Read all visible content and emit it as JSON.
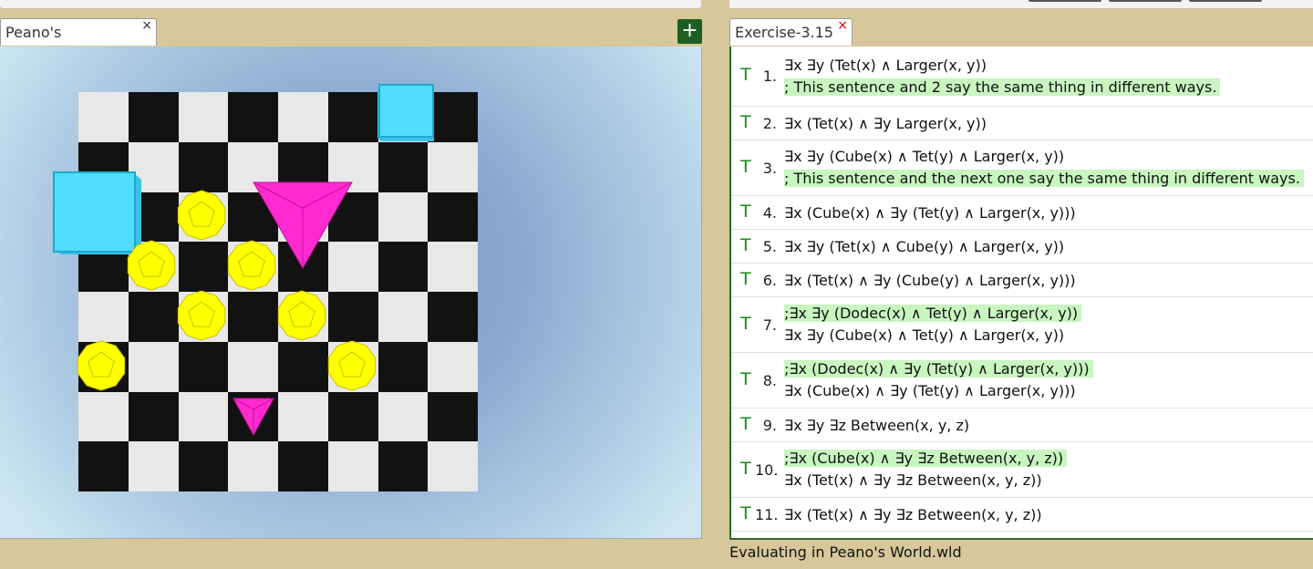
{
  "tabs": {
    "world": {
      "label": "Peano's World.wld",
      "close": "×"
    },
    "exercise": {
      "label": "Exercise-3.15",
      "close": "×"
    }
  },
  "toolbar": {
    "add_label": "+"
  },
  "colors": {
    "truth": "#1a8a1a",
    "comment_bg": "#c8f5c0",
    "cube": "#55ddff",
    "tet": "#ff2ad0",
    "dodec": "#ffff00",
    "add_button": "#1f5e23"
  },
  "sentences": [
    {
      "truth": "T",
      "num": "1.",
      "lines": [
        {
          "text": "∃x ∃y (Tet(x) ∧ Larger(x, y))",
          "comment": false
        },
        {
          "text": "; This sentence and 2 say the same thing in different ways.",
          "comment": true
        }
      ]
    },
    {
      "truth": "T",
      "num": "2.",
      "lines": [
        {
          "text": "∃x (Tet(x) ∧ ∃y Larger(x, y))",
          "comment": false
        }
      ]
    },
    {
      "truth": "T",
      "num": "3.",
      "lines": [
        {
          "text": "∃x ∃y (Cube(x) ∧ Tet(y) ∧ Larger(x, y))",
          "comment": false
        },
        {
          "text": "; This sentence and the next one say the same thing in different ways.",
          "comment": true
        }
      ]
    },
    {
      "truth": "T",
      "num": "4.",
      "lines": [
        {
          "text": "∃x (Cube(x) ∧ ∃y (Tet(y) ∧ Larger(x, y)))",
          "comment": false
        }
      ]
    },
    {
      "truth": "T",
      "num": "5.",
      "lines": [
        {
          "text": "∃x ∃y (Tet(x) ∧ Cube(y) ∧ Larger(x, y))",
          "comment": false
        }
      ]
    },
    {
      "truth": "T",
      "num": "6.",
      "lines": [
        {
          "text": "∃x (Tet(x) ∧ ∃y (Cube(y) ∧ Larger(x, y)))",
          "comment": false
        }
      ]
    },
    {
      "truth": "T",
      "num": "7.",
      "lines": [
        {
          "text": ";∃x ∃y (Dodec(x) ∧ Tet(y) ∧ Larger(x, y))",
          "comment": true
        },
        {
          "text": "∃x ∃y (Cube(x) ∧ Tet(y) ∧ Larger(x, y))",
          "comment": false
        }
      ]
    },
    {
      "truth": "T",
      "num": "8.",
      "lines": [
        {
          "text": ";∃x (Dodec(x) ∧ ∃y (Tet(y) ∧ Larger(x, y)))",
          "comment": true
        },
        {
          "text": "∃x (Cube(x) ∧ ∃y (Tet(y) ∧ Larger(x, y)))",
          "comment": false
        }
      ]
    },
    {
      "truth": "T",
      "num": "9.",
      "lines": [
        {
          "text": "∃x ∃y ∃z Between(x, y, z)",
          "comment": false
        }
      ]
    },
    {
      "truth": "T",
      "num": "10.",
      "lines": [
        {
          "text": ";∃x (Cube(x) ∧ ∃y ∃z Between(x, y, z))",
          "comment": true
        },
        {
          "text": "∃x (Tet(x) ∧ ∃y ∃z Between(x, y, z))",
          "comment": false
        }
      ]
    },
    {
      "truth": "T",
      "num": "11.",
      "lines": [
        {
          "text": "∃x (Tet(x) ∧ ∃y ∃z Between(x, y, z))",
          "comment": false
        }
      ]
    }
  ],
  "status": "Evaluating in Peano's World.wld"
}
